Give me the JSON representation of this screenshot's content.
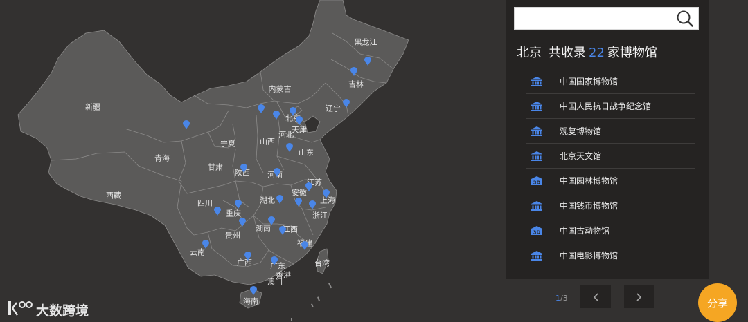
{
  "search": {
    "placeholder": "",
    "value": ""
  },
  "panel": {
    "city": "北京",
    "prefix": "共收录",
    "count": "22",
    "suffix": "家博物馆",
    "museums": [
      {
        "name": "中国国家博物馆",
        "icon": "museum-icon"
      },
      {
        "name": "中国人民抗日战争纪念馆",
        "icon": "museum-icon"
      },
      {
        "name": "观复博物馆",
        "icon": "museum-icon"
      },
      {
        "name": "北京天文馆",
        "icon": "museum-icon"
      },
      {
        "name": "中国园林博物馆",
        "icon": "museum-3d-icon"
      },
      {
        "name": "中国钱币博物馆",
        "icon": "museum-icon"
      },
      {
        "name": "中国古动物馆",
        "icon": "museum-3d-icon"
      },
      {
        "name": "中国电影博物馆",
        "icon": "museum-icon"
      }
    ]
  },
  "pagination": {
    "current": "1",
    "separator": "/",
    "total": "3"
  },
  "share": {
    "label": "分享"
  },
  "brand": {
    "name": "大数跨境"
  },
  "map": {
    "labels": [
      "黑龙江",
      "吉林",
      "辽宁",
      "内蒙古",
      "北京",
      "天津",
      "河北",
      "新疆",
      "宁夏",
      "山西",
      "山东",
      "青海",
      "甘肃",
      "陕西",
      "河南",
      "江苏",
      "安徽",
      "上海",
      "西藏",
      "四川",
      "湖北",
      "重庆",
      "浙江",
      "湖南",
      "江西",
      "贵州",
      "福建",
      "云南",
      "广西",
      "广东",
      "台湾",
      "香港",
      "澳门",
      "海南"
    ]
  },
  "colors": {
    "accent": "#4a86e8",
    "share": "#f5a623",
    "map_fill": "#5b5a59",
    "background": "#333130",
    "panel": "#252322"
  }
}
